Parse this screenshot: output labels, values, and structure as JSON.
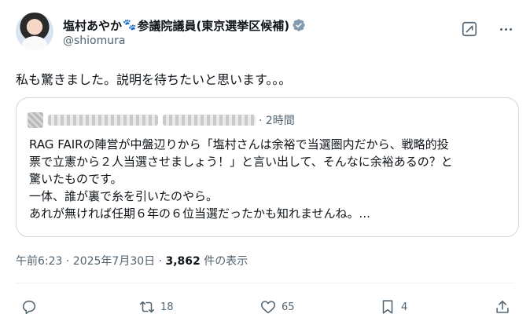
{
  "author": {
    "display_name": "塩村あやか",
    "paw_emoji": "🐾",
    "title_suffix": "参議院議員(東京選挙区候補)",
    "handle": "@shiomura"
  },
  "post": {
    "text": "私も驚きました。説明を待ちたいと思います。。。"
  },
  "quoted_post": {
    "time_ago": "· 2時間",
    "lines": [
      "RAG FAIRの陣営が中盤辺りから「塩村さんは余裕で当選圏内だから、戦略的投",
      "票で立憲から２人当選させましょう！」と言い出して、そんなに余裕あるの？と",
      "驚いたものです。",
      "一体、誰が裏で糸を引いたのやら。",
      "あれが無ければ任期６年の６位当選だったかも知れませんね。..."
    ]
  },
  "meta": {
    "timestamp": "午前6:23 · 2025年7月30日 · ",
    "views_count": "3,862",
    "views_label": " 件の表示"
  },
  "actions": {
    "reply_count": "",
    "repost_count": "18",
    "like_count": "65",
    "bookmark_count": "4"
  },
  "colors": {
    "text_primary": "#0f1419",
    "text_secondary": "#536471",
    "border": "#cfd9de",
    "verified": "#829aab"
  }
}
